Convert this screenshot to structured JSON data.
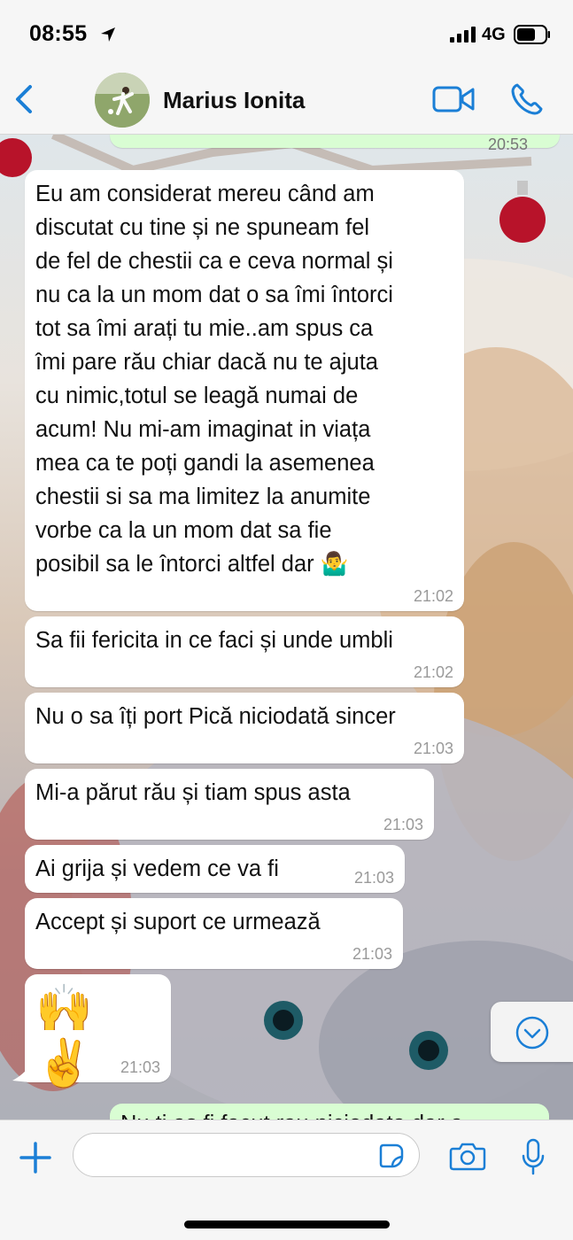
{
  "status": {
    "time": "08:55",
    "network": "4G"
  },
  "header": {
    "contact_name": "Marius Ionita"
  },
  "colors": {
    "accent": "#1b7fd6",
    "bubble_in": "#ffffff",
    "bubble_out": "#d9fdd3",
    "timestamp": "#9a9a9a"
  },
  "top_partial_message": {
    "time": "20:53"
  },
  "messages": [
    {
      "text": "Eu am considerat mereu când am\ndiscutat cu tine și ne spuneam fel\nde fel de chestii ca e ceva normal și\nnu ca la un mom dat o sa îmi întorci\ntot sa îmi arați tu mie..am spus ca\nîmi pare rău chiar dacă nu te ajuta\ncu nimic,totul se leagă numai de\nacum! Nu mi-am imaginat in viața\nmea ca te poți gandi la asemenea\nchestii si sa ma limitez la anumite\nvorbe ca la un mom dat sa fie\nposibil sa le întorci altfel dar 🤷‍♂️",
      "time": "21:02"
    },
    {
      "text": "Sa fii fericita in ce faci și unde umbli",
      "time": "21:02"
    },
    {
      "text": "Nu o sa îți port Pică niciodată sincer",
      "time": "21:03"
    },
    {
      "text": "Mi-a părut rău și tiam spus asta",
      "time": "21:03"
    },
    {
      "text": "Ai grija și vedem ce va fi",
      "time": "21:03"
    },
    {
      "text": "Accept și suport ce urmează",
      "time": "21:03"
    },
    {
      "text": "🙌 ✌️",
      "time": "21:03"
    }
  ],
  "bottom_partial_message": {
    "text": "Nu ti as fi facut rau niciodata dar a"
  },
  "input": {
    "placeholder": ""
  },
  "icons": {
    "back": "chevron-left-icon",
    "video": "video-camera-icon",
    "phone": "phone-icon",
    "plus": "plus-icon",
    "sticker": "sticker-icon",
    "camera": "camera-icon",
    "mic": "microphone-icon",
    "scroll": "chevron-down-icon"
  }
}
